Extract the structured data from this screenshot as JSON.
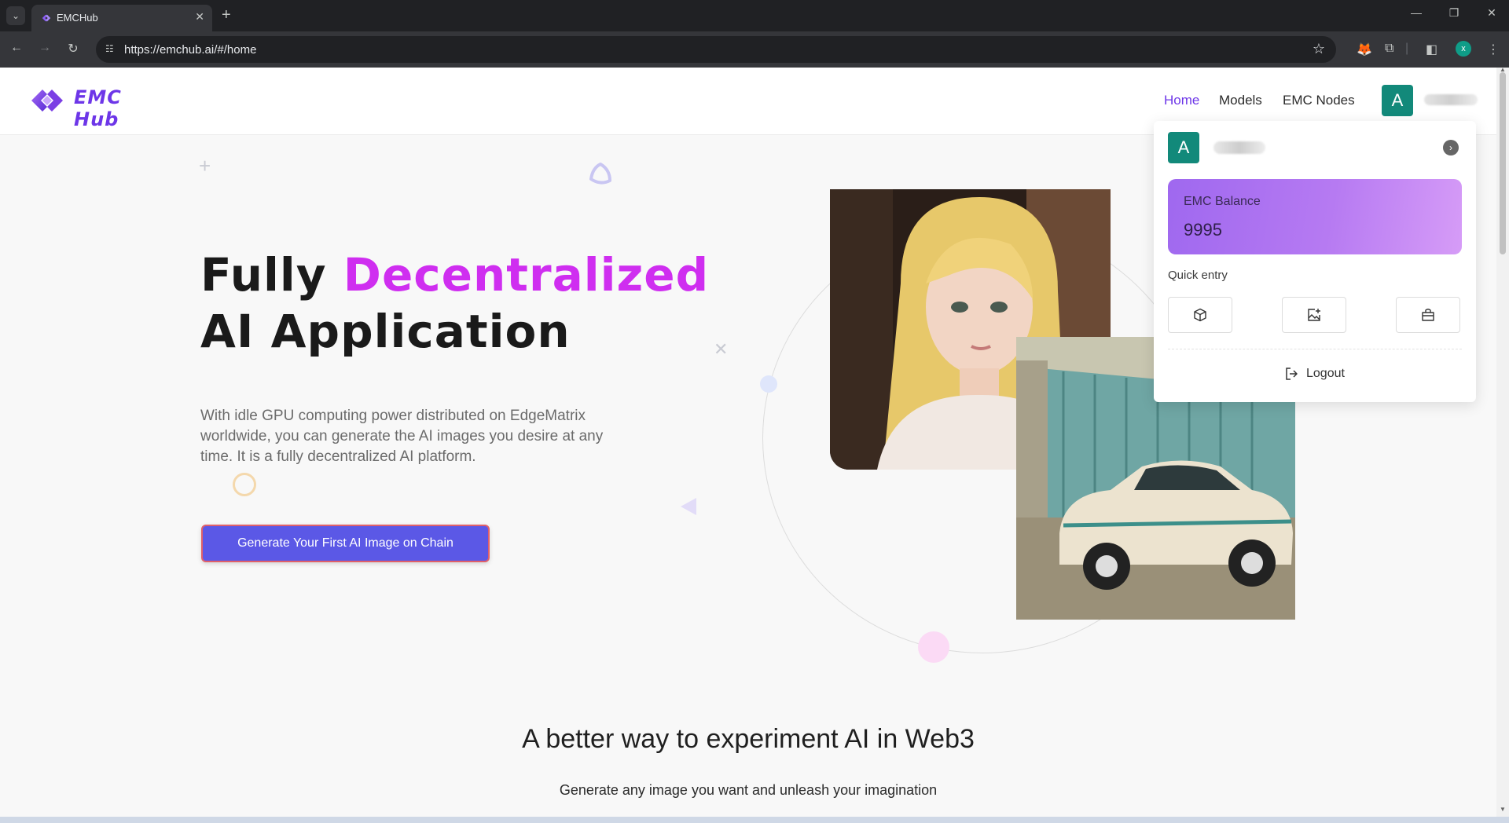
{
  "browser": {
    "tab_title": "EMCHub",
    "url": "https://emchub.ai/#/home",
    "profile_initial": "x"
  },
  "header": {
    "logo_text": "EMC Hub",
    "nav": [
      {
        "label": "Home",
        "active": true
      },
      {
        "label": "Models",
        "active": false
      },
      {
        "label": "EMC Nodes",
        "active": false
      }
    ],
    "avatar_initial": "A"
  },
  "hero": {
    "title_part1": "Fully ",
    "title_highlight": "Decentralized",
    "title_part2": "AI Application",
    "description": "With idle GPU computing power distributed on EdgeMatrix worldwide, you can generate the AI images you desire at any time. It is a fully decentralized AI platform.",
    "cta_label": "Generate Your First AI Image on Chain"
  },
  "dropdown": {
    "avatar_initial": "A",
    "balance_label": "EMC Balance",
    "balance_value": "9995",
    "quick_entry_label": "Quick entry",
    "quick_entries": [
      "cube-icon",
      "image-add-icon",
      "shop-bag-icon"
    ],
    "logout_label": "Logout"
  },
  "section": {
    "title": "A better way to experiment AI in Web3",
    "subtitle": "Generate any image you want and unleash your imagination"
  },
  "colors": {
    "accent": "#6d36e8",
    "highlight": "#cf2ef0",
    "cta": "#5b58e6",
    "avatar": "#12897a"
  }
}
